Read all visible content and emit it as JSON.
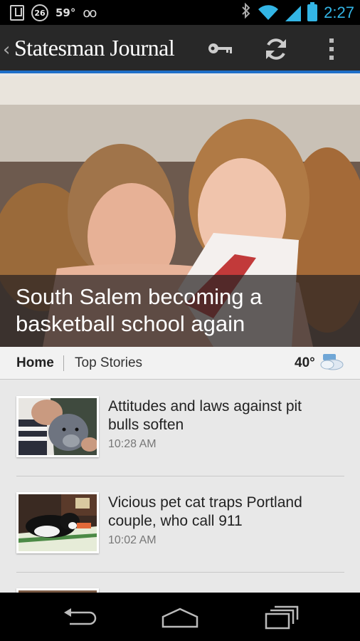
{
  "status_bar": {
    "notification_count": "26",
    "temperature": "59°",
    "voicemail_glyph": "oo",
    "time": "2:27",
    "icons": [
      "download-icon",
      "voicemail-icon",
      "bluetooth-icon",
      "wifi-icon",
      "signal-icon",
      "battery-icon"
    ]
  },
  "action_bar": {
    "title": "Statesman Journal",
    "back_glyph": "‹",
    "icons": [
      "key-icon",
      "refresh-icon",
      "overflow-menu-icon"
    ]
  },
  "hero": {
    "headline": "South Salem becoming a basketball school again"
  },
  "tabs": {
    "home": "Home",
    "top_stories": "Top Stories",
    "weather_temp": "40°",
    "weather_icon": "cloudy-weather-icon"
  },
  "articles": [
    {
      "title": "Attitudes and laws against pit bulls soften",
      "time": "10:28 AM"
    },
    {
      "title": "Vicious pet cat traps Portland couple, who call 911",
      "time": "10:02 AM"
    }
  ],
  "colors": {
    "accent": "#1e6ec8",
    "time_blue": "#33b5e5",
    "action_bar_bg": "#282828"
  }
}
